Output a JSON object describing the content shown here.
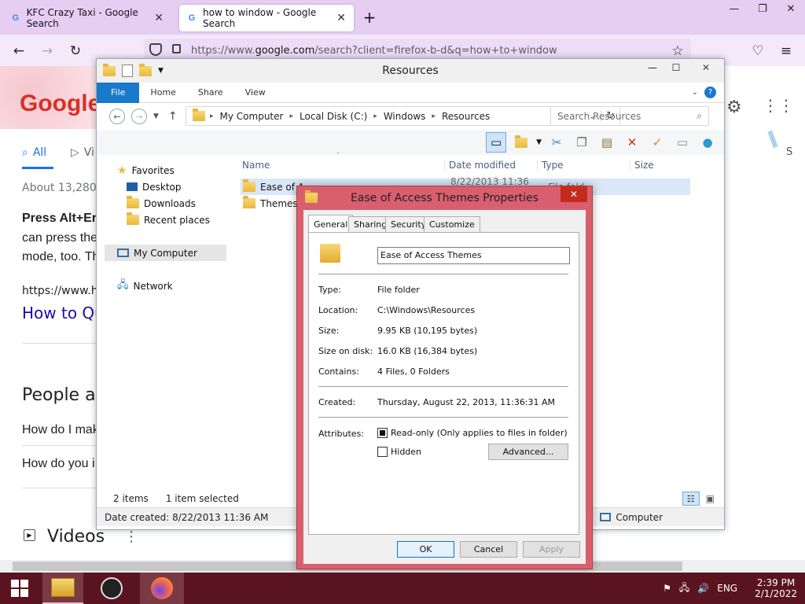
{
  "browser": {
    "tabs": [
      {
        "label": "KFC Crazy Taxi - Google Search",
        "active": false
      },
      {
        "label": "how to window - Google Search",
        "active": true
      }
    ],
    "new_tab": "+",
    "url_pre": "https://www.",
    "url_domain": "google.com",
    "url_post": "/search?client=firefox-b-d&q=how+to+window"
  },
  "google": {
    "tab_all": "All",
    "tab_videos": "Vi",
    "about": "About 13,280,0",
    "bold_line": "Press Alt+Er",
    "snippet_1": "can press the",
    "snippet_2": "mode, too. Th",
    "url_line": "https://www.how",
    "link": "How to Qu",
    "people_also": "People als",
    "q1": "How do I mak",
    "q2": "How do you i",
    "videos": "Videos",
    "edge_s": "S"
  },
  "explorer": {
    "title": "Resources",
    "ribbon_tabs": [
      "File",
      "Home",
      "Share",
      "View"
    ],
    "breadcrumb": [
      "My Computer",
      "Local Disk (C:)",
      "Windows",
      "Resources"
    ],
    "search_placeholder": "Search Resources",
    "nav": {
      "favorites": "Favorites",
      "desktop": "Desktop",
      "downloads": "Downloads",
      "recent": "Recent places",
      "my_computer": "My Computer",
      "network": "Network"
    },
    "columns": [
      "Name",
      "Date modified",
      "Type",
      "Size"
    ],
    "rows": [
      {
        "name": "Ease of A",
        "date": "8/22/2013 11:36 AM",
        "type": "File fold"
      },
      {
        "name": "Themes",
        "date": "",
        "type": ""
      }
    ],
    "status_items": "2 items",
    "status_selected": "1 item selected",
    "details": "Date created: 8/22/2013 11:36 AM",
    "details_right": "Computer"
  },
  "dialog": {
    "title": "Ease of Access Themes Properties",
    "close": "✕",
    "tabs": [
      "General",
      "Sharing",
      "Security",
      "Customize"
    ],
    "name_value": "Ease of Access Themes",
    "props": [
      {
        "label": "Type:",
        "value": "File folder"
      },
      {
        "label": "Location:",
        "value": "C:\\Windows\\Resources"
      },
      {
        "label": "Size:",
        "value": "9.95 KB (10,195 bytes)"
      },
      {
        "label": "Size on disk:",
        "value": "16.0 KB (16,384 bytes)"
      },
      {
        "label": "Contains:",
        "value": "4 Files, 0 Folders"
      }
    ],
    "created_label": "Created:",
    "created_value": "Thursday, August 22, 2013, 11:36:31 AM",
    "attributes_label": "Attributes:",
    "readonly": "Read-only (Only applies to files in folder)",
    "readonly_checked": true,
    "hidden": "Hidden",
    "hidden_checked": false,
    "advanced": "Advanced...",
    "ok": "OK",
    "cancel": "Cancel",
    "apply": "Apply"
  },
  "taskbar": {
    "lang": "ENG",
    "time": "2:39 PM",
    "date": "2/1/2022"
  },
  "colors": {
    "firefox_tabbar": "#e6cdf2",
    "dialog_frame": "#d95f6f",
    "taskbar": "#5a1420",
    "ribbon_file": "#1979ca"
  }
}
